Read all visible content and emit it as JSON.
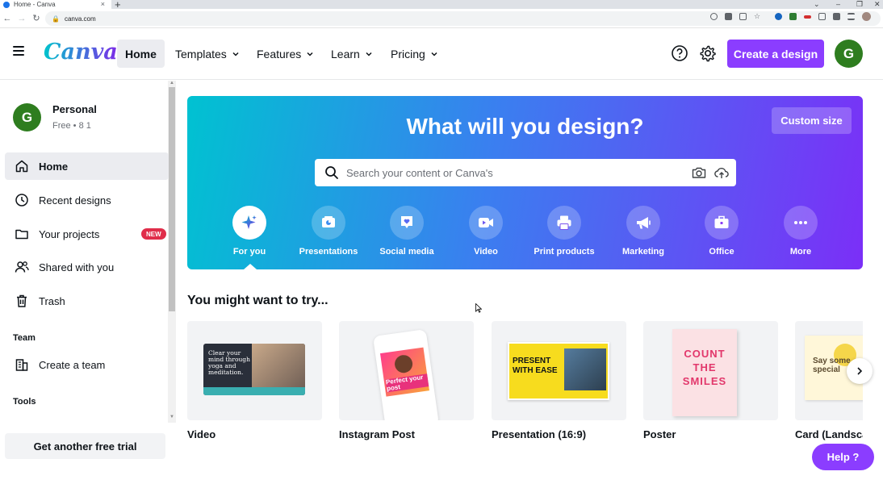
{
  "browser": {
    "tab_title": "Home - Canva",
    "tab_close": "×",
    "new_tab": "+",
    "url": "canva.com",
    "window_controls": [
      "⌄",
      "–",
      "❐",
      "✕"
    ]
  },
  "header": {
    "logo": "Canva",
    "nav": [
      {
        "label": "Home",
        "active": true
      },
      {
        "label": "Templates",
        "chevron": true
      },
      {
        "label": "Features",
        "chevron": true
      },
      {
        "label": "Learn",
        "chevron": true
      },
      {
        "label": "Pricing",
        "chevron": true
      }
    ],
    "create_button": "Create a design",
    "avatar_initial": "G"
  },
  "sidebar": {
    "profile": {
      "initial": "G",
      "name": "Personal",
      "plan": "Free • 8 1"
    },
    "items": [
      {
        "label": "Home",
        "icon": "home-icon",
        "active": true
      },
      {
        "label": "Recent designs",
        "icon": "clock-icon"
      },
      {
        "label": "Your projects",
        "icon": "folder-icon",
        "badge": "NEW"
      },
      {
        "label": "Shared with you",
        "icon": "people-icon"
      },
      {
        "label": "Trash",
        "icon": "trash-icon"
      }
    ],
    "team_section": "Team",
    "team_items": [
      {
        "label": "Create a team",
        "icon": "building-icon"
      }
    ],
    "tools_section": "Tools",
    "trial_button": "Get another free trial"
  },
  "hero": {
    "title": "What will you design?",
    "custom_size": "Custom size",
    "search_placeholder": "Search your content or Canva's",
    "categories": [
      {
        "label": "For you",
        "icon": "sparkle-icon",
        "active": true
      },
      {
        "label": "Presentations",
        "icon": "presentation-icon"
      },
      {
        "label": "Social media",
        "icon": "heart-icon"
      },
      {
        "label": "Video",
        "icon": "video-icon"
      },
      {
        "label": "Print products",
        "icon": "printer-icon"
      },
      {
        "label": "Marketing",
        "icon": "megaphone-icon"
      },
      {
        "label": "Office",
        "icon": "briefcase-icon"
      },
      {
        "label": "More",
        "icon": "more-icon"
      }
    ]
  },
  "suggestions": {
    "title": "You might want to try...",
    "cards": [
      {
        "label": "Video",
        "thumb_text": "Clear your mind through yoga and meditation."
      },
      {
        "label": "Instagram Post",
        "thumb_text": "Perfect your post"
      },
      {
        "label": "Presentation (16:9)",
        "thumb_text": "PRESENT WITH EASE"
      },
      {
        "label": "Poster",
        "thumb_text": "COUNT THE SMILES"
      },
      {
        "label": "Card (Landscape)",
        "thumb_text": "Say some special"
      }
    ]
  },
  "help_button": "Help ?",
  "colors": {
    "brand_purple": "#8b3dff",
    "brand_teal": "#00c4cc",
    "avatar_green": "#2e7d1f",
    "badge_red": "#e02d4a"
  }
}
